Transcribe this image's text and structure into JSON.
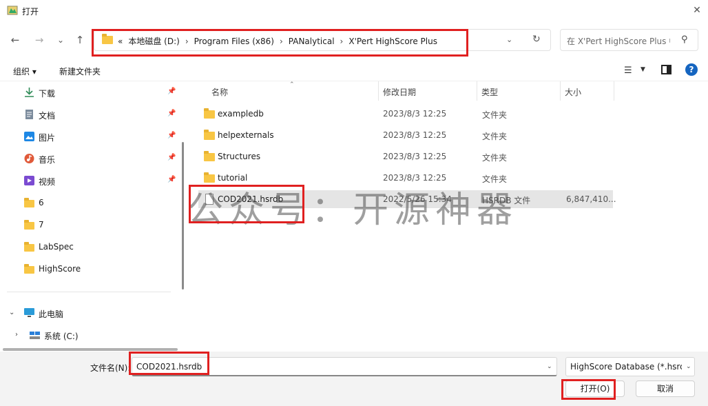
{
  "window": {
    "title": "打开",
    "close_glyph": "✕"
  },
  "nav": {
    "back_glyph": "←",
    "forward_glyph": "→",
    "recent_glyph": "⌄",
    "up_glyph": "↑",
    "breadcrumb_overflow": "«",
    "breadcrumbs": [
      "本地磁盘 (D:)",
      "Program Files (x86)",
      "PANalytical",
      "X'Pert HighScore Plus"
    ],
    "crumb_sep": "›",
    "refresh_glyph": "↻",
    "dropdown_glyph": "⌄"
  },
  "search": {
    "placeholder": "在 X'Pert HighScore Plus 中搜索",
    "icon_glyph": "⚲"
  },
  "toolbar": {
    "organize_label": "组织 ▾",
    "new_folder_label": "新建文件夹",
    "help_glyph": "?",
    "view_glyph": "☰",
    "view_dd_glyph": "▼"
  },
  "sidebar": {
    "pin_glyph": "📌",
    "quick_access": [
      {
        "label": "下载",
        "icon": "download-icon",
        "color": "#2e8b57"
      },
      {
        "label": "文档",
        "icon": "document-icon",
        "color": "#6b7b8c"
      },
      {
        "label": "图片",
        "icon": "picture-icon",
        "color": "#1e88e5"
      },
      {
        "label": "音乐",
        "icon": "music-icon",
        "color": "#e05a3a"
      },
      {
        "label": "视频",
        "icon": "video-icon",
        "color": "#7b4bd1"
      }
    ],
    "folders": [
      "6",
      "7",
      "LabSpec",
      "HighScore"
    ],
    "this_pc": {
      "label": "此电脑",
      "expander": "⌄"
    },
    "drive_c": {
      "label": "系统 (C:)",
      "expander": "›"
    }
  },
  "columns": {
    "name": "名称",
    "date": "修改日期",
    "type": "类型",
    "size": "大小",
    "sort_glyph": "⌃"
  },
  "files": [
    {
      "name": "exampledb",
      "date": "2023/8/3 12:25",
      "type": "文件夹",
      "size": "",
      "kind": "folder"
    },
    {
      "name": "helpexternals",
      "date": "2023/8/3 12:25",
      "type": "文件夹",
      "size": "",
      "kind": "folder"
    },
    {
      "name": "Structures",
      "date": "2023/8/3 12:25",
      "type": "文件夹",
      "size": "",
      "kind": "folder"
    },
    {
      "name": "tutorial",
      "date": "2023/8/3 12:25",
      "type": "文件夹",
      "size": "",
      "kind": "folder"
    },
    {
      "name": "COD2021.hsrdb",
      "date": "2022/5/26 15:34",
      "type": "HSRDB 文件",
      "size": "6,847,410...",
      "kind": "file",
      "selected": true
    }
  ],
  "watermark": "公众号：开源神器",
  "footer": {
    "filename_label": "文件名(N):",
    "filename_value": "COD2021.hsrdb",
    "filter_value": "HighScore Database (*.hsrdb)",
    "open_label": "打开(O)",
    "cancel_label": "取消",
    "dropdown_glyph": "⌄"
  },
  "colors": {
    "highlight": "#e02020",
    "folder": "#f8c644",
    "selected_row": "#e5e5e5",
    "help": "#1565c0"
  }
}
